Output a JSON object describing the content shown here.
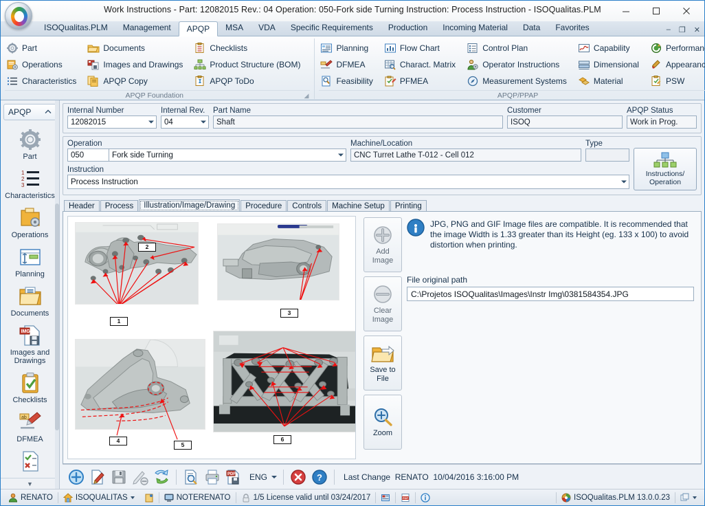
{
  "window": {
    "title": "Work Instructions  - Part: 12082015 Rev.: 04 Operation: 050-Fork side Turning Instruction: Process Instruction - ISOQualitas.PLM",
    "minimize": "–",
    "maximize": "☐",
    "close": "✕"
  },
  "menubar": {
    "tabs": [
      {
        "label": "ISOQualitas.PLM",
        "active": false
      },
      {
        "label": "Management",
        "active": false
      },
      {
        "label": "APQP",
        "active": true
      },
      {
        "label": "MSA",
        "active": false
      },
      {
        "label": "VDA",
        "active": false
      },
      {
        "label": "Specific Requirements",
        "active": false
      },
      {
        "label": "Production",
        "active": false
      },
      {
        "label": "Incoming Material",
        "active": false
      },
      {
        "label": "Data",
        "active": false
      },
      {
        "label": "Favorites",
        "active": false
      }
    ],
    "doc_minimize": "–",
    "doc_restore": "❐",
    "doc_close": "✕"
  },
  "ribbon": {
    "groups": [
      {
        "title": "APQP Foundation",
        "columns": [
          [
            {
              "label": "Part",
              "icon": "gear-icon"
            },
            {
              "label": "Operations",
              "icon": "operations-icon"
            },
            {
              "label": "Characteristics",
              "icon": "list-icon"
            }
          ],
          [
            {
              "label": "Documents",
              "icon": "documents-icon"
            },
            {
              "label": "Images and Drawings",
              "icon": "images-icon"
            },
            {
              "label": "APQP Copy",
              "icon": "copy-icon"
            }
          ],
          [
            {
              "label": "Checklists",
              "icon": "checklist-icon"
            },
            {
              "label": "Product Structure (BOM)",
              "icon": "bom-icon"
            },
            {
              "label": "APQP ToDo",
              "icon": "todo-icon"
            }
          ]
        ]
      },
      {
        "title": "APQP/PPAP",
        "columns": [
          [
            {
              "label": "Planning",
              "icon": "planning-icon"
            },
            {
              "label": "DFMEA",
              "icon": "dfmea-icon"
            },
            {
              "label": "Feasibility",
              "icon": "feasibility-icon"
            }
          ],
          [
            {
              "label": "Flow Chart",
              "icon": "flowchart-icon"
            },
            {
              "label": "Charact. Matrix",
              "icon": "matrix-icon"
            },
            {
              "label": "PFMEA",
              "icon": "pfmea-icon"
            }
          ],
          [
            {
              "label": "Control Plan",
              "icon": "controlplan-icon"
            },
            {
              "label": "Operator Instructions",
              "icon": "operator-icon"
            },
            {
              "label": "Measurement Systems",
              "icon": "measurement-icon"
            }
          ],
          [
            {
              "label": "Capability",
              "icon": "capability-icon"
            },
            {
              "label": "Dimensional",
              "icon": "dimensional-icon"
            },
            {
              "label": "Material",
              "icon": "material-icon"
            }
          ],
          [
            {
              "label": "Performance",
              "icon": "performance-icon"
            },
            {
              "label": "Appearance",
              "icon": "appearance-icon"
            },
            {
              "label": "PSW",
              "icon": "psw-icon"
            }
          ]
        ]
      },
      {
        "title": "...",
        "icon_only": true,
        "items": [
          {
            "label": "",
            "icon": "numbered-list-icon"
          },
          {
            "label": "",
            "icon": "flag-icon"
          },
          {
            "label": "",
            "icon": "grid-report-icon"
          }
        ]
      }
    ]
  },
  "sidebar": {
    "header": "APQP",
    "items": [
      {
        "label": "Part",
        "icon": "gear-icon"
      },
      {
        "label": "Characteristics",
        "icon": "numbered-list-icon"
      },
      {
        "label": "Operations",
        "icon": "operations-folder-icon"
      },
      {
        "label": "Planning",
        "icon": "planning-icon"
      },
      {
        "label": "Documents",
        "icon": "documents-folder-icon"
      },
      {
        "label": "Images and Drawings",
        "icon": "image-save-icon"
      },
      {
        "label": "Checklists",
        "icon": "clipboard-check-icon"
      },
      {
        "label": "DFMEA",
        "icon": "highlighter-icon"
      },
      {
        "label": "",
        "icon": "checkcross-doc-icon"
      }
    ],
    "scroll_down": "▼"
  },
  "header_form": {
    "internal_number": {
      "label": "Internal Number",
      "value": "12082015"
    },
    "internal_rev": {
      "label": "Internal Rev.",
      "value": "04"
    },
    "part_name": {
      "label": "Part Name",
      "value": "Shaft"
    },
    "customer": {
      "label": "Customer",
      "value": "ISOQ"
    },
    "apqp_status": {
      "label": "APQP Status",
      "value": "Work in Prog."
    }
  },
  "operation_form": {
    "operation_label": "Operation",
    "operation_number": "050",
    "operation_name": "Fork side Turning",
    "machine_label": "Machine/Location",
    "machine_value": "CNC Turret Lathe  T-012 -  Cell 012",
    "type_label": "Type",
    "type_value": "",
    "instruction_label": "Instruction",
    "instruction_value": "Process Instruction",
    "instructions_operation_button": "Instructions/\nOperation",
    "instructions_operation_line1": "Instructions/",
    "instructions_operation_line2": "Operation"
  },
  "tabs": [
    {
      "label": "Header",
      "active": false
    },
    {
      "label": "Process",
      "active": false
    },
    {
      "label": "Illustration/Image/Drawing",
      "active": true
    },
    {
      "label": "Procedure",
      "active": false
    },
    {
      "label": "Controls",
      "active": false
    },
    {
      "label": "Machine Setup",
      "active": false
    },
    {
      "label": "Printing",
      "active": false
    }
  ],
  "image_panel": {
    "callouts": [
      "1",
      "2",
      "3",
      "4",
      "5",
      "6"
    ],
    "photos": [
      {
        "id": "photo-top-left",
        "description": "Aluminum bracket casting front view with red arrow annotations"
      },
      {
        "id": "photo-top-right",
        "description": "Aluminum bracket casting side view with red arrow annotations"
      },
      {
        "id": "photo-bottom-left",
        "description": "Aluminum bracket casting rear view with red dashed outlines"
      },
      {
        "id": "photo-bottom-right",
        "description": "Aluminum bracket casting ribbed view with red arrow annotations"
      }
    ]
  },
  "action_buttons": [
    {
      "label_line1": "Add",
      "label_line2": "Image",
      "icon": "plus-circle-icon",
      "enabled": false
    },
    {
      "label_line1": "Clear",
      "label_line2": "Image",
      "icon": "minus-circle-icon",
      "enabled": false
    },
    {
      "label_line1": "Save to",
      "label_line2": "File",
      "icon": "folder-save-icon",
      "enabled": true
    },
    {
      "label_line1": "Zoom",
      "label_line2": "",
      "icon": "magnifier-plus-icon",
      "enabled": true
    }
  ],
  "info": {
    "icon": "info-icon",
    "text": "JPG, PNG and GIF Image files are compatible. It is recommended that the image Width is 1.33 greater than its Height (eg. 133 x 100) to avoid distortion when printing.",
    "path_label": "File original path",
    "path_value": "C:\\Projetos ISOQualitas\\Images\\Instr Img\\0381584354.JPG"
  },
  "bottom_toolbar": {
    "buttons": [
      {
        "name": "new-record-button",
        "icon": "plus-circle-blue-icon"
      },
      {
        "name": "edit-button",
        "icon": "pencil-doc-icon"
      },
      {
        "name": "save-button",
        "icon": "floppy-icon"
      },
      {
        "name": "cancel-edit-button",
        "icon": "pencil-cancel-icon"
      },
      {
        "name": "refresh-button",
        "icon": "refresh-icon"
      },
      {
        "name": "preview-button",
        "icon": "doc-search-icon"
      },
      {
        "name": "print-button",
        "icon": "printer-icon"
      },
      {
        "name": "export-pdf-button",
        "icon": "pdf-save-icon"
      }
    ],
    "language": "ENG",
    "delete_button": "close-red-icon",
    "help_button": "help-blue-icon",
    "last_change_label": "Last Change",
    "last_change_user": "RENATO",
    "last_change_date": "10/04/2016 3:16:00 PM"
  },
  "statusbar": {
    "user": "RENATO",
    "company": "ISOQUALITAS",
    "notes_icon": "note-icon",
    "machine": "NOTERENATO",
    "license": "1/5 License valid until 03/24/2017",
    "report_icon": "report-icon",
    "pdf_icon": "pdf-icon",
    "about_icon": "about-icon",
    "version": "ISOQualitas.PLM 13.0.0.23",
    "windows_icon": "cascade-icon"
  },
  "colors": {
    "accent": "#2a7fc9",
    "ribbon_text": "#15304a",
    "annotation_red": "#ee1111",
    "title_bg": "#ffffff"
  }
}
